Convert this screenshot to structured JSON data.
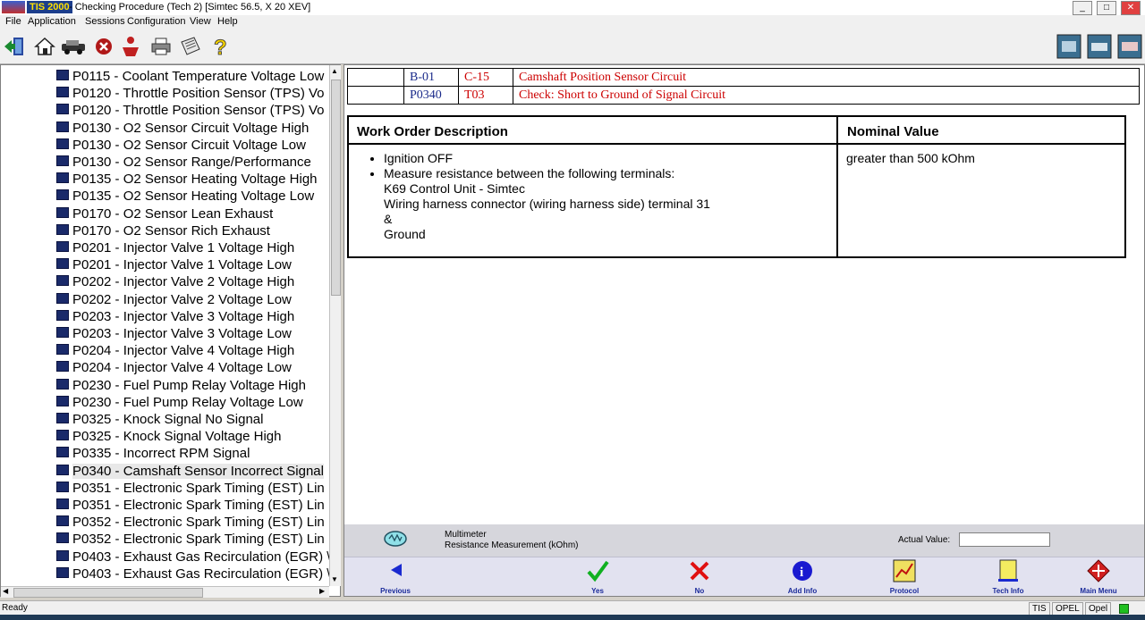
{
  "window": {
    "app_badge": "TIS 2000",
    "title_rest": "- Checking Procedure (Tech 2) [Simtec 56.5, X 20 XEV]",
    "controls": [
      "_",
      "□",
      "✕"
    ]
  },
  "menu": [
    "File",
    "Application",
    "Sessions",
    "Configuration",
    "View",
    "Help"
  ],
  "toolbar_icons": [
    "exit-icon",
    "home-icon",
    "vehicle-icon",
    "stop-icon",
    "person-icon",
    "print-icon",
    "notes-icon",
    "help-icon"
  ],
  "toolbar_right_icons": [
    "tech2-icon",
    "tool-icon",
    "car-diagnostic-icon"
  ],
  "tree": [
    "P0115 - Coolant Temperature Voltage Low",
    "P0120 - Throttle Position Sensor (TPS) Vo",
    "P0120 - Throttle Position Sensor (TPS) Vo",
    "P0130 - O2 Sensor Circuit Voltage High",
    "P0130 - O2 Sensor Circuit Voltage Low",
    "P0130 - O2 Sensor Range/Performance",
    "P0135 - O2 Sensor Heating Voltage High",
    "P0135 - O2 Sensor Heating Voltage Low",
    "P0170 - O2 Sensor Lean Exhaust",
    "P0170 - O2 Sensor Rich Exhaust",
    "P0201 - Injector Valve 1 Voltage High",
    "P0201 - Injector Valve 1 Voltage Low",
    "P0202 - Injector Valve 2 Voltage High",
    "P0202 - Injector Valve 2 Voltage Low",
    "P0203 - Injector Valve 3 Voltage High",
    "P0203 - Injector Valve 3 Voltage Low",
    "P0204 - Injector Valve 4 Voltage High",
    "P0204 - Injector Valve 4 Voltage Low",
    "P0230 - Fuel Pump Relay Voltage High",
    "P0230 - Fuel Pump Relay Voltage Low",
    "P0325 - Knock Signal No Signal",
    "P0325 - Knock Signal Voltage High",
    "P0335 - Incorrect RPM Signal",
    "P0340 - Camshaft Sensor Incorrect Signal",
    "P0351 - Electronic Spark Timing (EST) Lin",
    "P0351 - Electronic Spark Timing (EST) Lin",
    "P0352 - Electronic Spark Timing (EST) Lin",
    "P0352 - Electronic Spark Timing (EST) Lin",
    "P0403 - Exhaust Gas Recirculation (EGR) \\",
    "P0403 - Exhaust Gas Recirculation (EGR) \\"
  ],
  "tree_selected_index": 23,
  "steps": [
    {
      "code1": "B-01",
      "code2": "C-15",
      "desc": "Camshaft Position Sensor Circuit"
    },
    {
      "code1": "P0340",
      "code2": "T03",
      "desc": "Check: Short to Ground of Signal Circuit"
    }
  ],
  "work_order": {
    "header_desc": "Work Order Description",
    "header_nominal": "Nominal Value",
    "bullets": [
      "Ignition OFF",
      "Measure resistance between the following terminals:"
    ],
    "lines": [
      "K69 Control Unit - Simtec",
      "Wiring harness connector (wiring harness side) terminal 31",
      "&",
      "Ground"
    ],
    "nominal": "greater than 500 kOhm"
  },
  "measure": {
    "tool": "Multimeter",
    "type": "Resistance Measurement (kOhm)",
    "actual_label": "Actual Value:",
    "actual_value": ""
  },
  "actions": [
    {
      "name": "previous",
      "label": "Previous",
      "icon": "arrow-left-icon"
    },
    {
      "name": "yes",
      "label": "Yes",
      "icon": "check-icon"
    },
    {
      "name": "no",
      "label": "No",
      "icon": "cross-icon"
    },
    {
      "name": "add-info",
      "label": "Add Info",
      "icon": "info-icon"
    },
    {
      "name": "protocol",
      "label": "Protocol",
      "icon": "protocol-icon"
    },
    {
      "name": "tech-info",
      "label": "Tech Info",
      "icon": "tech-info-icon"
    },
    {
      "name": "main-menu",
      "label": "Main Menu",
      "icon": "main-menu-icon"
    }
  ],
  "status": {
    "text": "Ready",
    "cells": [
      "TIS",
      "OPEL",
      "Opel"
    ]
  },
  "colors": {
    "code1": "#1a2a8a",
    "code2": "#cc0000",
    "action_label": "#1a2a9a"
  }
}
